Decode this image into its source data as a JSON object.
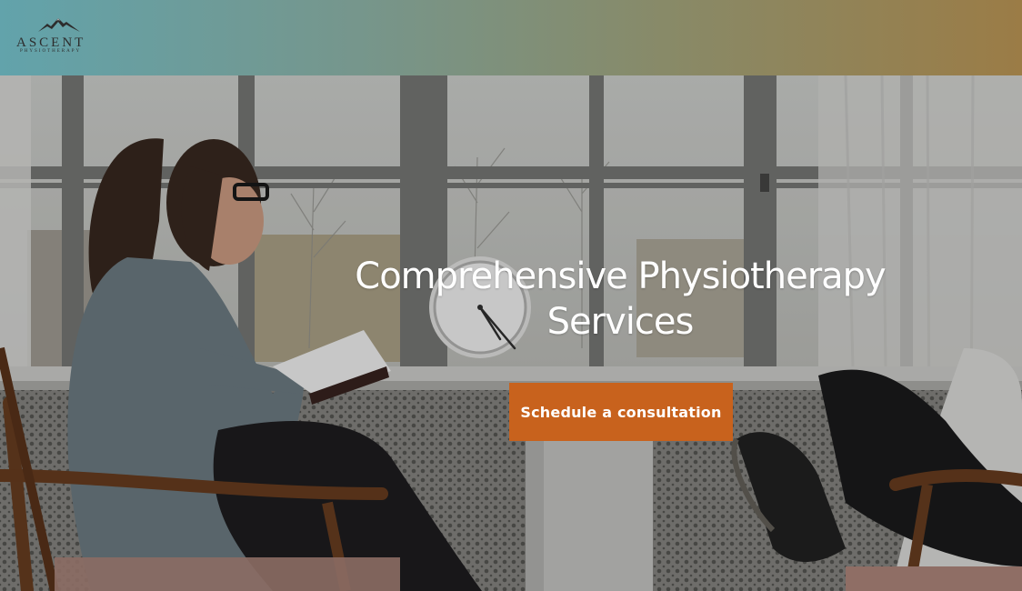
{
  "header": {
    "logo": {
      "name": "ASCENT",
      "subtitle": "PHYSIOTHERAPY",
      "icon": "mountain-icon"
    }
  },
  "hero": {
    "title_line1": "Comprehensive Physiotherapy",
    "title_line2": "Services",
    "cta_label": "Schedule a consultation",
    "background_image": "physiotherapy-consultation-photo"
  },
  "colors": {
    "header_gradient_start": "#62a3ab",
    "header_gradient_end": "#9b7c46",
    "cta_background": "#c8621d",
    "hero_text": "#ffffff"
  }
}
